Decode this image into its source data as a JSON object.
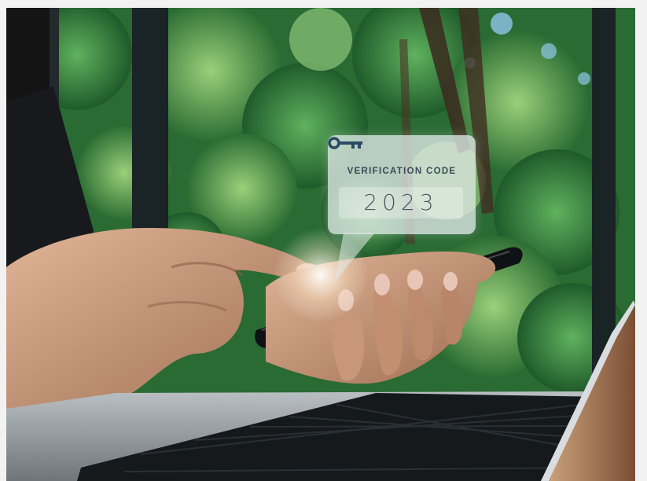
{
  "image": {
    "description_icon": "key-icon",
    "bubble": {
      "label": "VERIFICATION CODE",
      "code": "2023"
    },
    "colors": {
      "foliage": "#2f7a3a",
      "window_frame": "#1a2326",
      "bubble_bg": "#e1ebe8",
      "label_text": "#3b4b57",
      "laptop_body": "#9aa0a4",
      "keyboard": "#15191b"
    }
  }
}
